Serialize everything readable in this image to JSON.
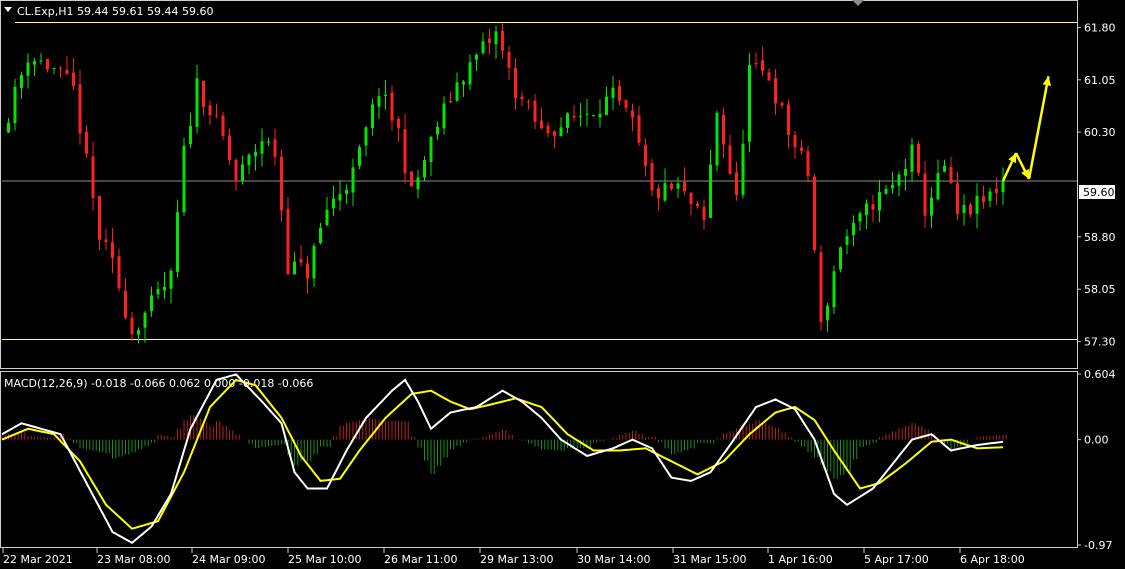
{
  "price_panel": {
    "header": "CL.Exp,H1  59.44 59.61 59.44 59.60",
    "price_scale": [
      "61.80",
      "61.05",
      "60.30",
      "59.60",
      "58.80",
      "58.05",
      "57.30"
    ],
    "current_price_label": "59.60"
  },
  "macd_panel": {
    "header": "MACD(12,26,9) -0.018 -0.066 0.062 0.000 -0.018 -0.066",
    "scale": [
      "0.604",
      "0.00",
      "-0.97"
    ]
  },
  "time_axis": {
    "labels": [
      "22 Mar 2021",
      "23 Mar 08:00",
      "24 Mar 09:00",
      "25 Mar 10:00",
      "26 Mar 11:00",
      "29 Mar 13:00",
      "30 Mar 14:00",
      "31 Mar 15:00",
      "1 Apr 16:00",
      "5 Apr 17:00",
      "6 Apr 18:00"
    ]
  },
  "colors": {
    "background": "#000000",
    "bull": "#00e600",
    "bear": "#ff2020",
    "level_line": "#ffff66",
    "projection": "#ffff00",
    "macd_line": "#ffffff",
    "signal_line": "#ffff00",
    "hist_pos": "#b22222",
    "hist_neg": "#1e8c1e"
  },
  "chart_data": [
    {
      "type": "candlestick",
      "symbol": "CL.Exp",
      "timeframe": "H1",
      "last_bar": {
        "open": 59.44,
        "high": 59.61,
        "low": 59.44,
        "close": 59.6
      },
      "ylim": [
        56.95,
        62.15
      ],
      "levels": [
        61.87,
        57.33
      ],
      "current_price": 59.6,
      "close_path": [
        [
          0,
          60.3
        ],
        [
          4,
          61.4
        ],
        [
          8,
          61.2
        ],
        [
          11,
          60.9
        ],
        [
          15,
          58.8
        ],
        [
          17,
          58.4
        ],
        [
          20,
          57.45
        ],
        [
          22,
          57.7
        ],
        [
          26,
          58.2
        ],
        [
          28,
          60.0
        ],
        [
          30,
          61.0
        ],
        [
          32,
          60.6
        ],
        [
          34,
          60.2
        ],
        [
          36,
          59.6
        ],
        [
          40,
          60.2
        ],
        [
          42,
          60.0
        ],
        [
          44,
          58.4
        ],
        [
          47,
          58.3
        ],
        [
          50,
          59.2
        ],
        [
          54,
          59.7
        ],
        [
          58,
          60.9
        ],
        [
          61,
          60.3
        ],
        [
          63,
          59.4
        ],
        [
          67,
          60.4
        ],
        [
          70,
          61.0
        ],
        [
          74,
          61.5
        ],
        [
          76,
          61.7
        ],
        [
          79,
          60.9
        ],
        [
          83,
          60.3
        ],
        [
          86,
          60.4
        ],
        [
          90,
          60.6
        ],
        [
          94,
          60.8
        ],
        [
          97,
          60.4
        ],
        [
          100,
          59.4
        ],
        [
          104,
          59.5
        ],
        [
          108,
          59.0
        ],
        [
          110,
          60.6
        ],
        [
          113,
          59.3
        ],
        [
          115,
          61.2
        ],
        [
          118,
          61.1
        ],
        [
          121,
          60.3
        ],
        [
          124,
          59.7
        ],
        [
          126,
          57.5
        ],
        [
          129,
          58.7
        ],
        [
          131,
          58.9
        ],
        [
          134,
          59.3
        ],
        [
          137,
          59.5
        ],
        [
          140,
          60.0
        ],
        [
          142,
          59.2
        ],
        [
          145,
          59.8
        ],
        [
          147,
          59.1
        ],
        [
          151,
          59.3
        ],
        [
          154,
          59.6
        ]
      ],
      "projection": [
        [
          154,
          59.6
        ],
        [
          156,
          60.0
        ],
        [
          158,
          59.63
        ],
        [
          161,
          61.1
        ]
      ]
    },
    {
      "type": "macd",
      "params": [
        12,
        26,
        9
      ],
      "values": {
        "main": -0.018,
        "signal": -0.066,
        "hist": 0.062
      },
      "ylim": [
        -0.97,
        0.604
      ],
      "macd_path": [
        [
          0,
          0.05
        ],
        [
          3,
          0.15
        ],
        [
          6,
          0.1
        ],
        [
          9,
          0.05
        ],
        [
          13,
          -0.4
        ],
        [
          17,
          -0.85
        ],
        [
          20,
          -0.95
        ],
        [
          23,
          -0.8
        ],
        [
          26,
          -0.5
        ],
        [
          29,
          0.1
        ],
        [
          33,
          0.55
        ],
        [
          36,
          0.6
        ],
        [
          40,
          0.35
        ],
        [
          43,
          0.15
        ],
        [
          45,
          -0.3
        ],
        [
          47,
          -0.45
        ],
        [
          50,
          -0.45
        ],
        [
          53,
          -0.1
        ],
        [
          56,
          0.2
        ],
        [
          60,
          0.45
        ],
        [
          62,
          0.55
        ],
        [
          64,
          0.35
        ],
        [
          66,
          0.1
        ],
        [
          69,
          0.25
        ],
        [
          73,
          0.3
        ],
        [
          77,
          0.45
        ],
        [
          80,
          0.35
        ],
        [
          83,
          0.2
        ],
        [
          86,
          0.0
        ],
        [
          90,
          -0.15
        ],
        [
          94,
          -0.08
        ],
        [
          97,
          0.0
        ],
        [
          100,
          -0.08
        ],
        [
          103,
          -0.35
        ],
        [
          106,
          -0.38
        ],
        [
          109,
          -0.3
        ],
        [
          112,
          -0.05
        ],
        [
          116,
          0.3
        ],
        [
          119,
          0.37
        ],
        [
          122,
          0.28
        ],
        [
          125,
          0.0
        ],
        [
          128,
          -0.5
        ],
        [
          130,
          -0.6
        ],
        [
          134,
          -0.45
        ],
        [
          138,
          -0.15
        ],
        [
          140,
          0.0
        ],
        [
          143,
          0.05
        ],
        [
          146,
          -0.1
        ],
        [
          150,
          -0.05
        ],
        [
          154,
          -0.02
        ]
      ],
      "signal_path": [
        [
          0,
          0.0
        ],
        [
          4,
          0.1
        ],
        [
          8,
          0.05
        ],
        [
          12,
          -0.2
        ],
        [
          16,
          -0.6
        ],
        [
          20,
          -0.82
        ],
        [
          24,
          -0.75
        ],
        [
          28,
          -0.3
        ],
        [
          32,
          0.3
        ],
        [
          36,
          0.55
        ],
        [
          39,
          0.5
        ],
        [
          43,
          0.2
        ],
        [
          46,
          -0.15
        ],
        [
          49,
          -0.38
        ],
        [
          52,
          -0.36
        ],
        [
          55,
          -0.1
        ],
        [
          59,
          0.2
        ],
        [
          63,
          0.42
        ],
        [
          66,
          0.45
        ],
        [
          69,
          0.35
        ],
        [
          72,
          0.28
        ],
        [
          75,
          0.32
        ],
        [
          79,
          0.38
        ],
        [
          83,
          0.3
        ],
        [
          87,
          0.05
        ],
        [
          91,
          -0.1
        ],
        [
          95,
          -0.1
        ],
        [
          99,
          -0.08
        ],
        [
          103,
          -0.2
        ],
        [
          107,
          -0.32
        ],
        [
          111,
          -0.2
        ],
        [
          115,
          0.05
        ],
        [
          119,
          0.25
        ],
        [
          122,
          0.3
        ],
        [
          125,
          0.18
        ],
        [
          128,
          -0.1
        ],
        [
          132,
          -0.45
        ],
        [
          135,
          -0.4
        ],
        [
          139,
          -0.22
        ],
        [
          143,
          -0.02
        ],
        [
          146,
          0.0
        ],
        [
          150,
          -0.08
        ],
        [
          154,
          -0.07
        ]
      ]
    }
  ]
}
